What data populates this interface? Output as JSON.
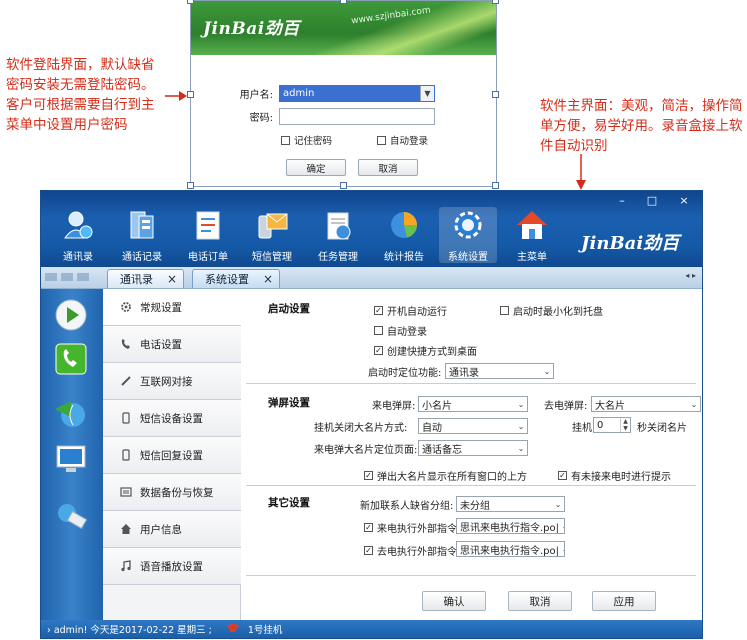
{
  "annotations": {
    "left": "软件登陆界面，默认缺省密码安装无需登陆密码。客户可根据需要自行到主菜单中设置用户密码",
    "right": "软件主界面：美观，简洁，操作简单方便，易学好用。录音盒接上软件自动识别"
  },
  "login": {
    "brand": "JinBai劲百",
    "url": "www.szjinbai.com",
    "username_label": "用户名:",
    "username_value": "admin",
    "password_label": "密码:",
    "remember_label": "记住密码",
    "autologin_label": "自动登录",
    "ok_label": "确定",
    "cancel_label": "取消"
  },
  "window": {
    "brand": "JinBai劲百",
    "controls": [
      "–",
      "□",
      "×"
    ],
    "toolbar": [
      {
        "label": "通讯录",
        "icon": "contacts-icon"
      },
      {
        "label": "通话记录",
        "icon": "call-log-icon"
      },
      {
        "label": "电话订单",
        "icon": "order-icon"
      },
      {
        "label": "短信管理",
        "icon": "sms-icon"
      },
      {
        "label": "任务管理",
        "icon": "task-icon"
      },
      {
        "label": "统计报告",
        "icon": "report-icon"
      },
      {
        "label": "系统设置",
        "icon": "settings-icon"
      },
      {
        "label": "主菜单",
        "icon": "home-icon"
      }
    ],
    "tabs": [
      {
        "label": "通讯录",
        "close": "×"
      },
      {
        "label": "系统设置",
        "close": "×"
      }
    ],
    "tab_scroll": "◂ ▸"
  },
  "menu": [
    {
      "label": "常规设置",
      "icon": "gear-icon"
    },
    {
      "label": "电话设置",
      "icon": "phone-icon"
    },
    {
      "label": "互联网对接",
      "icon": "link-icon"
    },
    {
      "label": "短信设备设置",
      "icon": "device-icon"
    },
    {
      "label": "短信回复设置",
      "icon": "reply-icon"
    },
    {
      "label": "数据备份与恢复",
      "icon": "backup-icon"
    },
    {
      "label": "用户信息",
      "icon": "user-icon"
    },
    {
      "label": "语音播放设置",
      "icon": "music-icon"
    }
  ],
  "settings": {
    "startup": {
      "title": "启动设置",
      "autorun": "开机自动运行",
      "minimize": "启动时最小化到托盘",
      "autologin": "自动登录",
      "shortcut": "创建快捷方式到桌面",
      "locate_label": "启动时定位功能:",
      "locate_value": "通讯录"
    },
    "popup": {
      "title": "弹屏设置",
      "incoming_label": "来电弹屏:",
      "incoming_value": "小名片",
      "outgoing_label": "去电弹屏:",
      "outgoing_value": "大名片",
      "close_mode_label": "挂机关闭大名片方式:",
      "close_mode_value": "自动",
      "hangup_label": "挂机",
      "hangup_value": "0",
      "hangup_suffix": "秒关闭名片",
      "locate_label": "来电弹大名片定位页面:",
      "locate_value": "通话备忘",
      "top_most": "弹出大名片显示在所有窗口的上方",
      "missed": "有未接来电时进行提示"
    },
    "other": {
      "title": "其它设置",
      "group_label": "新加联系人缺省分组:",
      "group_value": "未分组",
      "in_cmd": "来电执行外部指令",
      "in_cmd_value": "思讯来电执行指令.po|",
      "out_cmd": "去电执行外部指令",
      "out_cmd_value": "思讯来电执行指令.po|"
    },
    "buttons": {
      "confirm": "确认",
      "cancel": "取消",
      "apply": "应用"
    }
  },
  "status": {
    "text": "› admin! 今天是2017-02-22 星期三 ;",
    "line": "1号挂机"
  }
}
